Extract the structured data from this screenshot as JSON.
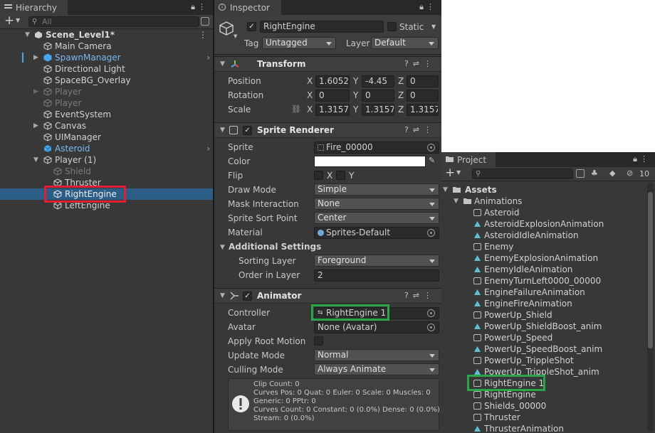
{
  "colors": {
    "selection": "#2c5d87",
    "highlight_red": "#e01f30",
    "highlight_green": "#2aa54a",
    "blue_text": "#7bb8ef"
  },
  "hierarchy": {
    "tab": "Hierarchy",
    "search_placeholder": "All",
    "add_label": "+",
    "items": [
      {
        "label": "Scene_Level1*",
        "icon": "unity-scene-icon"
      },
      {
        "label": "Main Camera",
        "icon": "cube-icon"
      },
      {
        "label": "SpawnManager",
        "icon": "prefab-cube-icon"
      },
      {
        "label": "Directional Light",
        "icon": "cube-icon"
      },
      {
        "label": "SpaceBG_Overlay",
        "icon": "cube-icon"
      },
      {
        "label": "Player",
        "icon": "cube-icon"
      },
      {
        "label": "Player",
        "icon": "cube-icon"
      },
      {
        "label": "EventSystem",
        "icon": "cube-icon"
      },
      {
        "label": "Canvas",
        "icon": "cube-icon"
      },
      {
        "label": "UIManager",
        "icon": "cube-icon"
      },
      {
        "label": "Asteroid",
        "icon": "prefab-cube-icon"
      },
      {
        "label": "Player (1)",
        "icon": "cube-icon"
      },
      {
        "label": "Shield",
        "icon": "cube-icon"
      },
      {
        "label": "Thruster",
        "icon": "cube-icon"
      },
      {
        "label": "RightEngine",
        "icon": "cube-icon"
      },
      {
        "label": "LeftEngine",
        "icon": "cube-icon"
      }
    ]
  },
  "inspector": {
    "tab": "Inspector",
    "object_name": "RightEngine",
    "static_label": "Static",
    "tag_label": "Tag",
    "tag_value": "Untagged",
    "layer_label": "Layer",
    "layer_value": "Default",
    "transform": {
      "title": "Transform",
      "position_label": "Position",
      "position": {
        "x": "1.6052",
        "y": "-4.45",
        "z": "0"
      },
      "rotation_label": "Rotation",
      "rotation": {
        "x": "0",
        "y": "0",
        "z": "0"
      },
      "scale_label": "Scale",
      "scale": {
        "x": "1.3157",
        "y": "1.3157",
        "z": "1.3157"
      },
      "axis_x": "X",
      "axis_y": "Y",
      "axis_z": "Z"
    },
    "sprite_renderer": {
      "title": "Sprite Renderer",
      "sprite_label": "Sprite",
      "sprite_value": "Fire_00000",
      "color_label": "Color",
      "flip_label": "Flip",
      "flip_x": "X",
      "flip_y": "Y",
      "draw_mode_label": "Draw Mode",
      "draw_mode_value": "Simple",
      "mask_label": "Mask Interaction",
      "mask_value": "None",
      "sort_point_label": "Sprite Sort Point",
      "sort_point_value": "Center",
      "material_label": "Material",
      "material_value": "Sprites-Default",
      "additional_label": "Additional Settings",
      "sorting_layer_label": "Sorting Layer",
      "sorting_layer_value": "Foreground",
      "order_label": "Order in Layer",
      "order_value": "2"
    },
    "animator": {
      "title": "Animator",
      "controller_label": "Controller",
      "controller_value": "RightEngine 1",
      "avatar_label": "Avatar",
      "avatar_value": "None (Avatar)",
      "root_motion_label": "Apply Root Motion",
      "update_label": "Update Mode",
      "update_value": "Normal",
      "culling_label": "Culling Mode",
      "culling_value": "Always Animate",
      "info": [
        "Clip Count: 0",
        "Curves Pos: 0 Quat: 0 Euler: 0 Scale: 0 Muscles: 0",
        "Generic: 0 PPtr: 0",
        "Curves Count: 0 Constant: 0 (0.0%) Dense: 0 (0.0%)",
        "Stream: 0 (0.0%)"
      ]
    }
  },
  "project": {
    "tab": "Project",
    "add_label": "+",
    "hidden_count": "10",
    "assets_label": "Assets",
    "animations_label": "Animations",
    "items": [
      {
        "label": "Asteroid",
        "type": "controller"
      },
      {
        "label": "AsteroidExplosionAnimation",
        "type": "clip"
      },
      {
        "label": "AsteroidIdleAnimation",
        "type": "clip"
      },
      {
        "label": "Enemy",
        "type": "controller"
      },
      {
        "label": "EnemyExplosionAnimation",
        "type": "clip"
      },
      {
        "label": "EnemyIdleAnimation",
        "type": "clip"
      },
      {
        "label": "EnemyTurnLeft0000_00000",
        "type": "controller"
      },
      {
        "label": "EngineFailureAnimation",
        "type": "clip"
      },
      {
        "label": "EngineFireAnimation",
        "type": "clip"
      },
      {
        "label": "PowerUp_Shield",
        "type": "controller"
      },
      {
        "label": "PowerUp_ShieldBoost_anim",
        "type": "clip"
      },
      {
        "label": "PowerUp_Speed",
        "type": "controller"
      },
      {
        "label": "PowerUp_SpeedBoost_anim",
        "type": "clip"
      },
      {
        "label": "PowerUp_TrippleShot",
        "type": "controller"
      },
      {
        "label": "PowerUp_TrippleShot_anim",
        "type": "clip"
      },
      {
        "label": "RightEngine 1",
        "type": "controller"
      },
      {
        "label": "RightEngine",
        "type": "controller"
      },
      {
        "label": "Shields_00000",
        "type": "controller"
      },
      {
        "label": "Thruster",
        "type": "controller"
      },
      {
        "label": "ThrusterAnimation",
        "type": "clip"
      }
    ]
  }
}
